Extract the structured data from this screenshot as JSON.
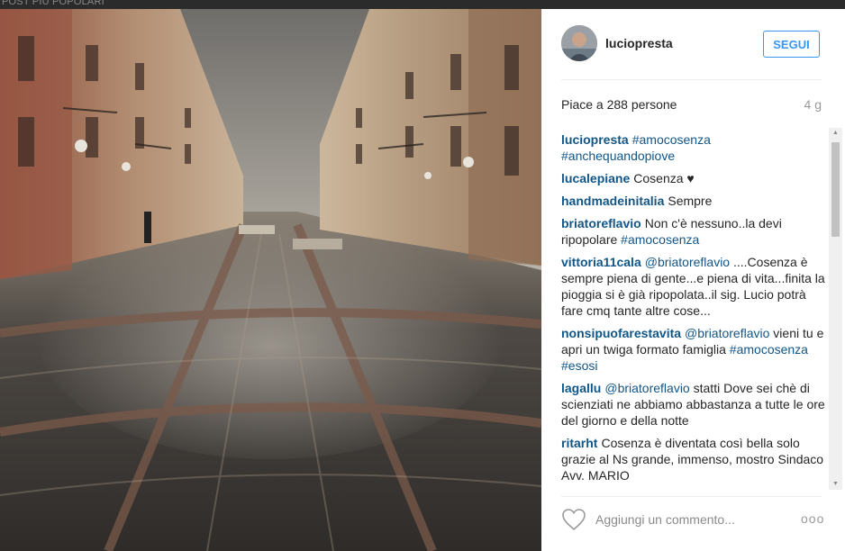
{
  "top_label": "POST PIÙ POPOLARI",
  "post": {
    "username": "luciopresta",
    "follow_label": "SEGUI",
    "likes": "Piace a 288 persone",
    "time_ago": "4 g"
  },
  "comments": [
    {
      "user": "luciopresta",
      "text": "#amocosenza #anchequandopiove"
    },
    {
      "user": "lucalepiane",
      "text": "Cosenza ♥"
    },
    {
      "user": "handmadeinitalia",
      "text": "Sempre"
    },
    {
      "user": "briatoreflavio",
      "text": "Non c'è nessuno..la devi ripopolare #amocosenza"
    },
    {
      "user": "vittoria11cala",
      "text": "@briatoreflavio ....Cosenza è sempre piena di gente...e piena di vita...finita la pioggia si è già ripopolata..il sig. Lucio potrà fare cmq tante altre cose..."
    },
    {
      "user": "nonsipuofarestavita",
      "text": "@briatoreflavio vieni tu e apri un twiga formato famiglia #amocosenza #esosi"
    },
    {
      "user": "lagallu",
      "text": "@briatoreflavio statti Dove sei chè di scienziati ne abbiamo abbastanza a tutte le ore del giorno e della notte"
    },
    {
      "user": "ritarht",
      "text": "Cosenza è diventata così bella solo grazie al Ns grande, immenso, mostro Sindaco Avv. MARIO"
    }
  ],
  "footer": {
    "comment_placeholder": "Aggiungi un commento...",
    "like_icon": "heart-outline-icon",
    "more_icon": "ellipsis-icon",
    "more_label": "ooo"
  },
  "colors": {
    "accent": "#3897f0",
    "link": "#125688",
    "muted": "#999999"
  }
}
